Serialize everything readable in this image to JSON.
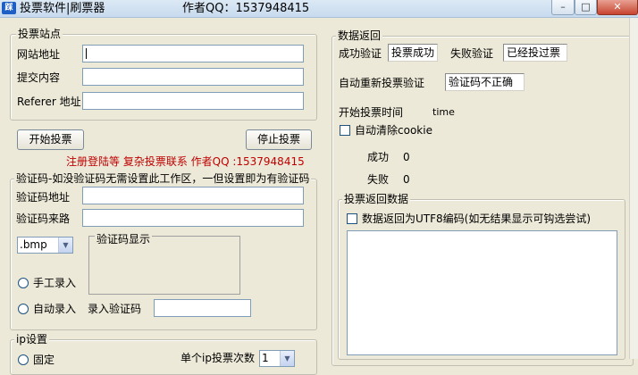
{
  "window": {
    "icon_text": "踩",
    "title": "投票软件|刷票器",
    "author": "作者QQ：1537948415",
    "min_glyph": "–",
    "max_glyph": "□",
    "close_glyph": "✕"
  },
  "site": {
    "legend": "投票站点",
    "url_label": "网站地址",
    "url_value": "",
    "content_label": "提交内容",
    "content_value": "",
    "referer_label": "Referer 地址",
    "referer_value": ""
  },
  "actions": {
    "start_label": "开始投票",
    "stop_label": "停止投票",
    "notice": "注册登陆等 复杂投票联系 作者QQ :1537948415"
  },
  "captcha": {
    "legend": "验证码-如没验证码无需设置此工作区，一但设置即为有验证码",
    "addr_label": "验证码地址",
    "addr_value": "",
    "source_label": "验证码来路",
    "source_value": "",
    "format_selected": ".bmp",
    "display_legend": "验证码显示",
    "manual_label": "手工录入",
    "auto_label": "自动录入",
    "input_label": "录入验证码",
    "input_value": ""
  },
  "ip": {
    "legend": "ip设置",
    "fixed_label": "固定",
    "single_ip_label": "单个ip投票次数",
    "count_value": "1"
  },
  "result": {
    "legend": "数据返回",
    "success_label": "成功验证",
    "success_value": "投票成功",
    "fail_label": "失败验证",
    "fail_value": "已经投过票",
    "auto_revote_label": "自动重新投票验证",
    "auto_revote_value": "验证码不正确",
    "start_time_label": "开始投票时间",
    "start_time_value": "time",
    "clear_cookie_label": "自动清除cookie",
    "success_count_label": "成功",
    "success_count": "0",
    "fail_count_label": "失败",
    "fail_count": "0"
  },
  "returned": {
    "legend": "投票返回数据",
    "utf8_label": "数据返回为UTF8编码(如无结果显示可钩选尝试)"
  }
}
